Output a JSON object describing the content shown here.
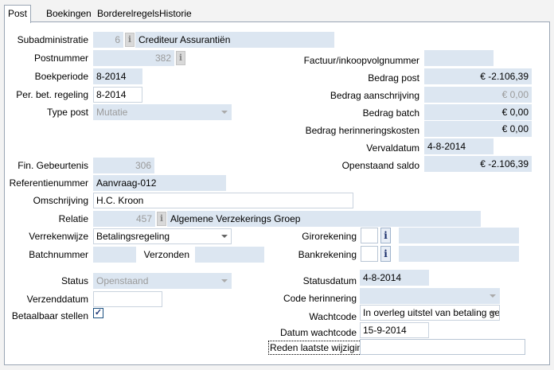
{
  "tabs": [
    "Post",
    "Boekingen",
    "Borderelregels",
    "Historie"
  ],
  "left": {
    "subadministratie_label": "Subadministratie",
    "subadministratie_num": "6",
    "subadministratie_name": "Crediteur Assurantiën",
    "postnummer_label": "Postnummer",
    "postnummer_value": "382",
    "boekperiode_label": "Boekperiode",
    "boekperiode_value": "8-2014",
    "per_bet_label": "Per. bet. regeling",
    "per_bet_value": "8-2014",
    "type_post_label": "Type post",
    "type_post_value": "Mutatie",
    "fin_gebeurtenis_label": "Fin. Gebeurtenis",
    "fin_gebeurtenis_value": "306",
    "referentienummer_label": "Referentienummer",
    "referentienummer_value": "Aanvraag-012",
    "omschrijving_label": "Omschrijving",
    "omschrijving_value": "H.C. Kroon",
    "relatie_label": "Relatie",
    "relatie_num": "457",
    "relatie_name": "Algemene Verzekerings Groep",
    "verrekenwijze_label": "Verrekenwijze",
    "verrekenwijze_value": "Betalingsregeling",
    "batchnummer_label": "Batchnummer",
    "batchnummer_value": "",
    "verzonden_label": "Verzonden",
    "verzonden_value": "",
    "status_label": "Status",
    "status_value": "Openstaand",
    "verzenddatum_label": "Verzenddatum",
    "verzenddatum_value": "",
    "betaalbaar_label": "Betaalbaar stellen",
    "betaalbaar_mark": "✓"
  },
  "right": {
    "factuur_label": "Factuur/inkoopvolgnummer",
    "factuur_value": "",
    "bedrag_post_label": "Bedrag post",
    "bedrag_post_value": "€ -2.106,39",
    "bedrag_aanschrijving_label": "Bedrag aanschrijving",
    "bedrag_aanschrijving_value": "€ 0,00",
    "bedrag_batch_label": "Bedrag batch",
    "bedrag_batch_value": "€ 0,00",
    "bedrag_herinnering_label": "Bedrag herinneringskosten",
    "bedrag_herinnering_value": "€ 0,00",
    "vervaldatum_label": "Vervaldatum",
    "vervaldatum_value": "4-8-2014",
    "openstaand_label": "Openstaand saldo",
    "openstaand_value": "€ -2.106,39",
    "girorekening_label": "Girorekening",
    "bankrekening_label": "Bankrekening",
    "statusdatum_label": "Statusdatum",
    "statusdatum_value": "4-8-2014",
    "code_herinnering_label": "Code herinnering",
    "code_herinnering_value": "",
    "wachtcode_label": "Wachtcode",
    "wachtcode_value": "In overleg uitstel van betaling ge",
    "datum_wachtcode_label": "Datum wachtcode",
    "datum_wachtcode_value": "15-9-2014",
    "reden_label": "Reden laatste wijziging",
    "reden_value": ""
  },
  "icons": {
    "info": "i"
  }
}
